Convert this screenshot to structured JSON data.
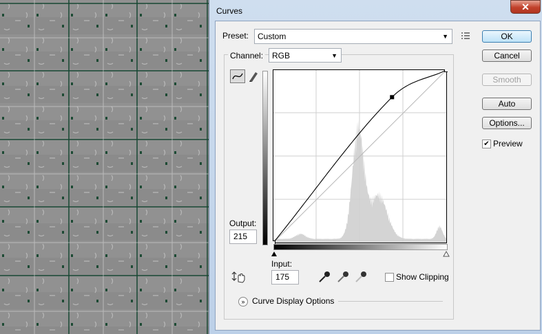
{
  "window": {
    "title": "Curves",
    "close_icon": "close-icon"
  },
  "preset": {
    "label": "Preset:",
    "value": "Custom"
  },
  "channel": {
    "label": "Channel:",
    "value": "RGB"
  },
  "buttons": {
    "ok": "OK",
    "cancel": "Cancel",
    "smooth": "Smooth",
    "auto": "Auto",
    "options": "Options..."
  },
  "preview": {
    "label": "Preview",
    "checked": true
  },
  "output": {
    "label": "Output:",
    "value": "215"
  },
  "input": {
    "label": "Input:",
    "value": "175"
  },
  "show_clipping": {
    "label": "Show Clipping",
    "checked": false
  },
  "curve_display_options": {
    "label": "Curve Display Options"
  },
  "curve_points": [
    [
      0,
      0
    ],
    [
      175,
      215
    ],
    [
      255,
      255
    ]
  ],
  "colors": {
    "accent": "#3c7fb1",
    "histogram": "#d4d4d4"
  }
}
